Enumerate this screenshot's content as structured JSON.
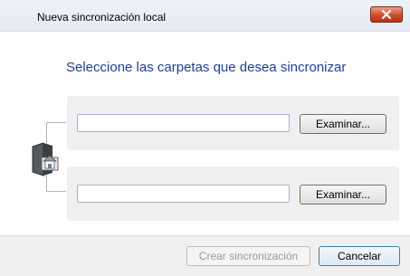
{
  "window": {
    "title": "Nueva sincronización local",
    "close_icon": "close-icon"
  },
  "main": {
    "heading": "Seleccione las carpetas que desea sincronizar",
    "folder_icon": "home-folder-icon",
    "folders": [
      {
        "value": "",
        "browse_label": "Examinar..."
      },
      {
        "value": "",
        "browse_label": "Examinar..."
      }
    ]
  },
  "footer": {
    "create_label": "Crear sincronización",
    "create_enabled": false,
    "cancel_label": "Cancelar"
  },
  "colors": {
    "heading": "#1f3f9f",
    "close_button": "#cf4c2d",
    "panel_background": "#f0f0f0"
  }
}
